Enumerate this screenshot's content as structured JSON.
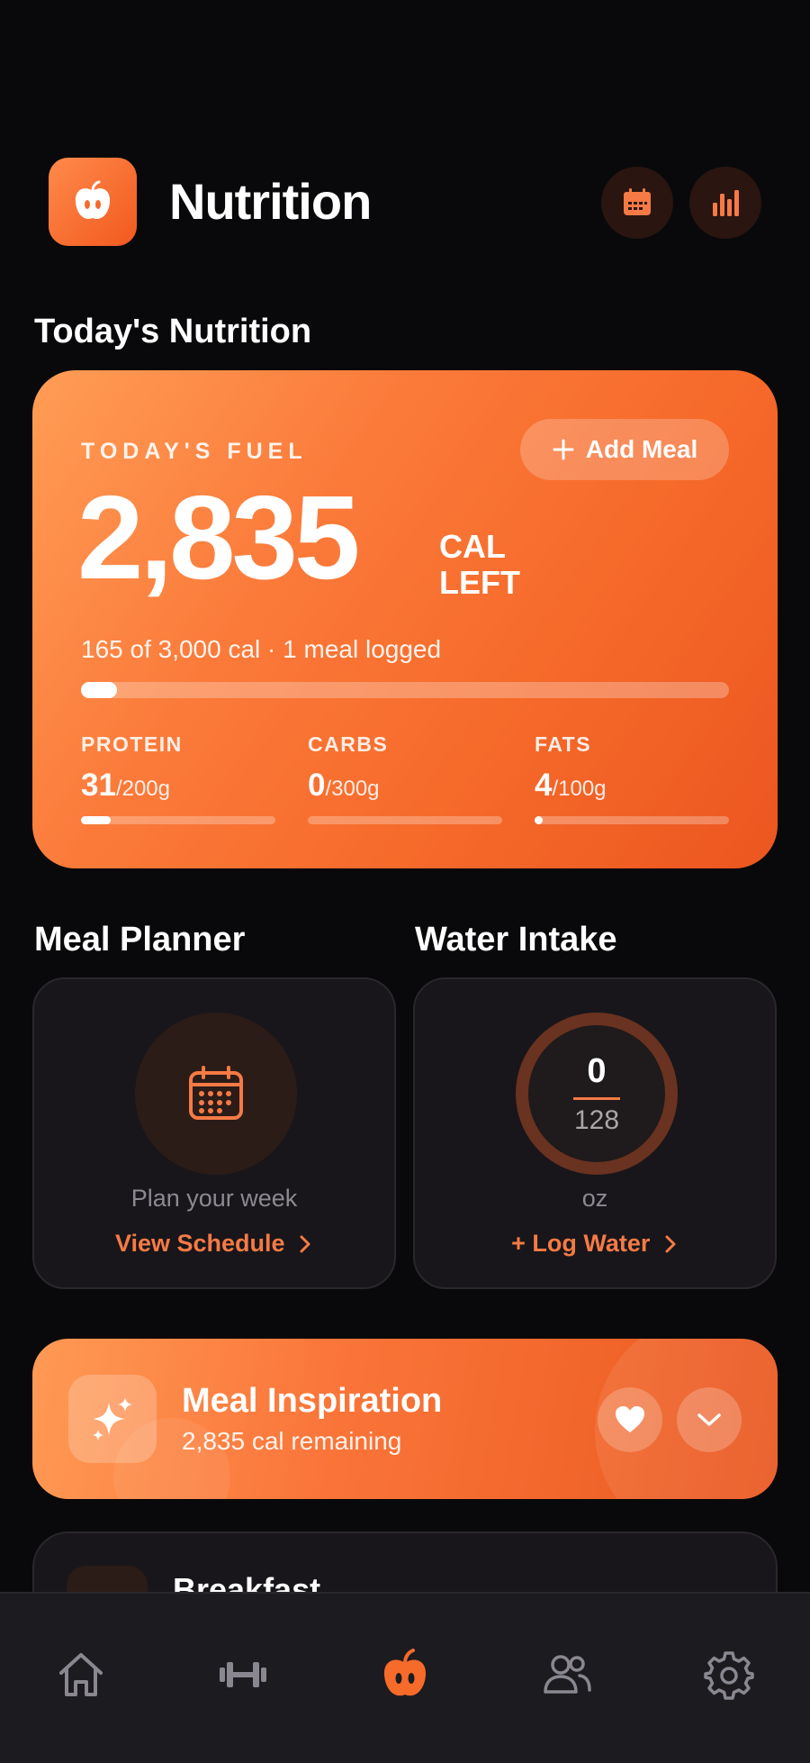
{
  "header": {
    "title": "Nutrition",
    "app_icon": "apple-icon",
    "calendar_icon": "calendar-icon",
    "stats_icon": "bar-chart-icon"
  },
  "today": {
    "section_title": "Today's Nutrition",
    "fuel_label": "TODAY'S FUEL",
    "add_meal_label": "Add Meal",
    "calories_left": "2,835",
    "cal_unit": "CAL",
    "left_label": "LEFT",
    "summary": "165 of 3,000 cal  ·  1 meal logged",
    "progress_fraction": 0.055,
    "macros": [
      {
        "label": "PROTEIN",
        "value": "31",
        "goal": "/200g",
        "fraction": 0.155
      },
      {
        "label": "CARBS",
        "value": "0",
        "goal": "/300g",
        "fraction": 0
      },
      {
        "label": "FATS",
        "value": "4",
        "goal": "/100g",
        "fraction": 0.04
      }
    ]
  },
  "meal_planner": {
    "title": "Meal Planner",
    "subtitle": "Plan your week",
    "link": "View Schedule"
  },
  "water": {
    "title": "Water Intake",
    "current": "0",
    "goal": "128",
    "unit": "oz",
    "link": "+ Log Water"
  },
  "inspiration": {
    "title": "Meal Inspiration",
    "subtitle": "2,835 cal remaining"
  },
  "breakfast": {
    "title": "Breakfast"
  },
  "nav": [
    "home-icon",
    "dumbbell-icon",
    "apple-icon",
    "users-icon",
    "settings-icon"
  ],
  "colors": {
    "accent": "#f57a45",
    "background": "#09090b",
    "card": "#18161a"
  }
}
